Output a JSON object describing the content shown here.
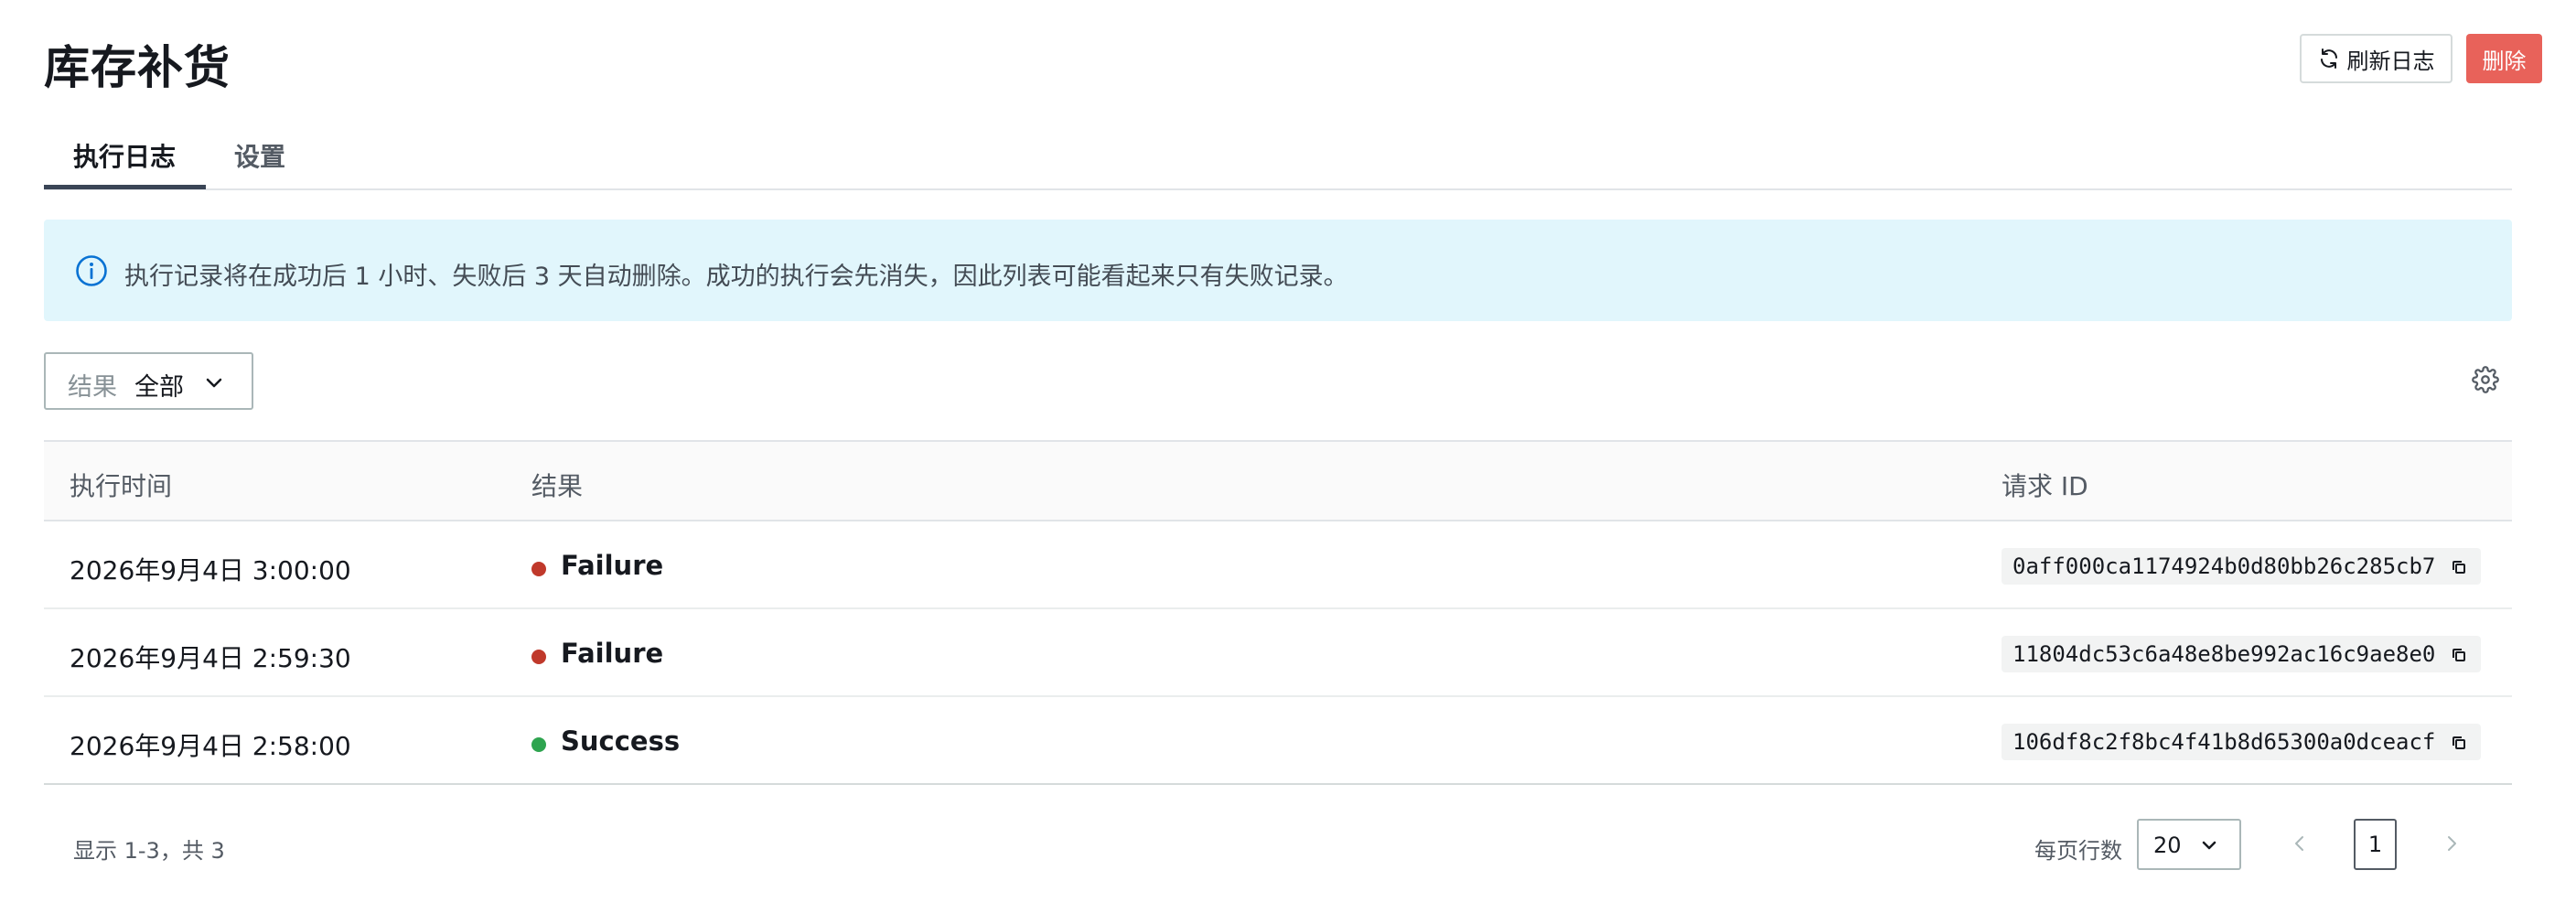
{
  "header": {
    "title": "库存补货",
    "refresh_label": "刷新日志",
    "delete_label": "删除"
  },
  "tabs": [
    {
      "label": "执行日志",
      "active": true
    },
    {
      "label": "设置",
      "active": false
    }
  ],
  "banner": {
    "icon": "info-icon",
    "text": "执行记录将在成功后 1 小时、失败后 3 天自动删除。成功的执行会先消失，因此列表可能看起来只有失败记录。"
  },
  "filter": {
    "label": "结果",
    "value": "全部"
  },
  "table": {
    "headers": {
      "time": "执行时间",
      "result": "结果",
      "request_id": "请求 ID"
    },
    "rows": [
      {
        "time": "2026年9月4日 3:00:00",
        "result": "Failure",
        "status_color": "#c0392b",
        "request_id": "0aff000ca1174924b0d80bb26c285cb7"
      },
      {
        "time": "2026年9月4日 2:59:30",
        "result": "Failure",
        "status_color": "#c0392b",
        "request_id": "11804dc53c6a48e8be992ac16c9ae8e0"
      },
      {
        "time": "2026年9月4日 2:58:00",
        "result": "Success",
        "status_color": "#2ea44f",
        "request_id": "106df8c2f8bc4f41b8d65300a0dceacf"
      }
    ]
  },
  "footer": {
    "summary": "显示 1-3，共 3",
    "rows_per_page_label": "每页行数",
    "rows_per_page_value": "20",
    "current_page": "1"
  },
  "colors": {
    "accent": "#3a4556",
    "delete": "#e8625a",
    "banner_bg": "#e1f6fc",
    "failure": "#c0392b",
    "success": "#2ea44f"
  }
}
